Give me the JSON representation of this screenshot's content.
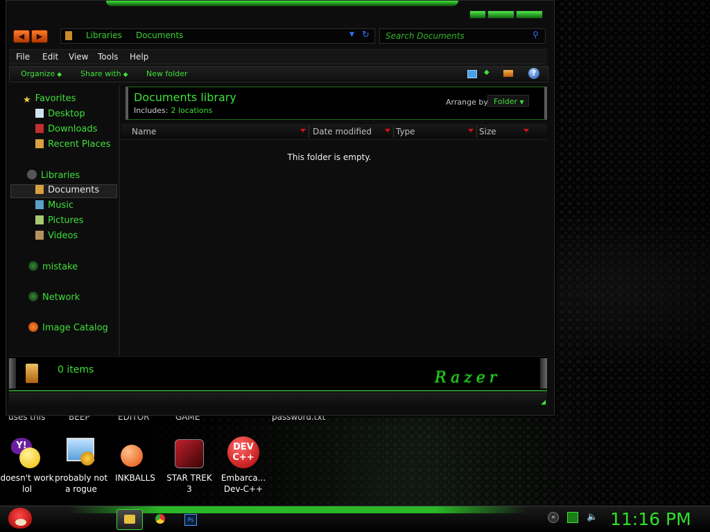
{
  "address": {
    "crumbs": [
      "Libraries",
      "Documents"
    ]
  },
  "search": {
    "placeholder": "Search Documents"
  },
  "menubar": [
    "File",
    "Edit",
    "View",
    "Tools",
    "Help"
  ],
  "toolbar": {
    "organize": "Organize",
    "share_with": "Share with",
    "new_folder": "New folder",
    "help": "?"
  },
  "nav": {
    "favorites": "Favorites",
    "desktop": "Desktop",
    "downloads": "Downloads",
    "recent_places": "Recent Places",
    "libraries": "Libraries",
    "documents": "Documents",
    "music": "Music",
    "pictures": "Pictures",
    "videos": "Videos",
    "homegroup": "mistake",
    "network": "Network",
    "image_catalog": "Image Catalog"
  },
  "library": {
    "title": "Documents library",
    "includes_label": "Includes:",
    "includes_link": "2 locations",
    "arrange_label": "Arrange by:",
    "arrange_value": "Folder"
  },
  "columns": [
    "Name",
    "Date modified",
    "Type",
    "Size"
  ],
  "empty_message": "This folder is empty.",
  "details": {
    "item_count": "0 items",
    "brand": "Razer"
  },
  "desktop": {
    "partial_labels": [
      "uses this",
      "BEEP",
      "EDITOR",
      "GAME",
      "password.txt"
    ],
    "icons": [
      {
        "label_1": "doesn't work",
        "label_2": "lol",
        "icon": "yahoo-messenger-icon"
      },
      {
        "label_1": "probably not",
        "label_2": "a rogue",
        "icon": "settings-monitor-icon"
      },
      {
        "label_1": "INKBALLS",
        "label_2": "",
        "icon": "inkball-icon"
      },
      {
        "label_1": "STAR TREK",
        "label_2": "3",
        "icon": "star-trek-game-icon"
      },
      {
        "label_1": "Embarca...",
        "label_2": "Dev-C++",
        "icon": "dev-cpp-icon",
        "badge": "DEV\nC++"
      }
    ]
  },
  "taskbar": {
    "clock": "11:16 PM",
    "ps_label": "Ps"
  },
  "colors": {
    "accent": "#3fe03a",
    "background": "#000000",
    "link": "#2e74ff"
  }
}
